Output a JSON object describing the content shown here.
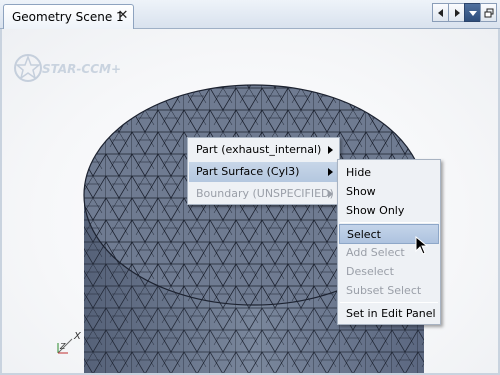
{
  "tab": {
    "title": "Geometry Scene 1",
    "close_glyph": "✕"
  },
  "toolbar": {
    "icons": [
      "prev-tab-icon",
      "next-tab-icon",
      "dropdown-icon",
      "restore-window-icon"
    ]
  },
  "viewport": {
    "logo_text": "STAR-CCM+",
    "axis_x_label": "X",
    "axis_z_label": "Z"
  },
  "context_menu": {
    "items": [
      {
        "label": "Part (exhaust_internal)",
        "submenu": true,
        "enabled": true
      },
      {
        "label": "Part Surface (Cyl3)",
        "submenu": true,
        "enabled": true,
        "active": true
      },
      {
        "label": "Boundary (UNSPECIFIED)",
        "submenu": true,
        "enabled": false
      }
    ]
  },
  "submenu": {
    "items": [
      {
        "label": "Hide",
        "enabled": true
      },
      {
        "label": "Show",
        "enabled": true
      },
      {
        "label": "Show Only",
        "enabled": true
      },
      {
        "label": "Select",
        "enabled": true,
        "hovered": true
      },
      {
        "label": "Add Select",
        "enabled": false
      },
      {
        "label": "Deselect",
        "enabled": false
      },
      {
        "label": "Subset Select",
        "enabled": false
      },
      {
        "label": "Set in Edit Panel",
        "enabled": true
      }
    ]
  },
  "colors": {
    "mesh_fill": "#6f7b91",
    "mesh_lines": "#1c2230",
    "menu_bg": "#eef1f5",
    "menu_highlight": "#b4c7df"
  }
}
